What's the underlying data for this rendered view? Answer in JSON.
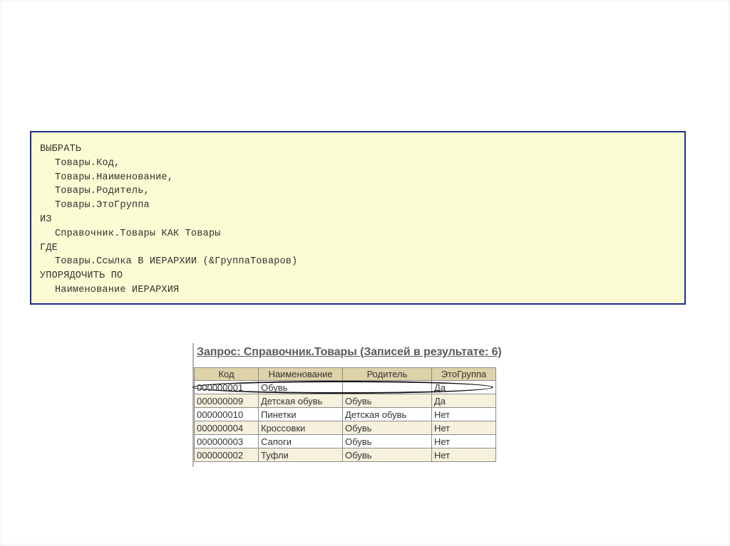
{
  "query": {
    "lines": [
      {
        "text": "ВЫБРАТЬ",
        "indent": false
      },
      {
        "text": "Товары.Код,",
        "indent": true
      },
      {
        "text": "Товары.Наименование,",
        "indent": true
      },
      {
        "text": "Товары.Родитель,",
        "indent": true
      },
      {
        "text": "Товары.ЭтоГруппа",
        "indent": true
      },
      {
        "text": "ИЗ",
        "indent": false
      },
      {
        "text": "Справочник.Товары КАК Товары",
        "indent": true
      },
      {
        "text": "ГДЕ",
        "indent": false
      },
      {
        "text": "Товары.Ссылка В ИЕРАРХИИ (&ГруппаТоваров)",
        "indent": true
      },
      {
        "text": "УПОРЯДОЧИТЬ ПО",
        "indent": false
      },
      {
        "text": "Наименование ИЕРАРХИЯ",
        "indent": true
      }
    ]
  },
  "result": {
    "title": "Запрос: Справочник.Товары (Записей в результате: 6)",
    "columns": [
      "Код",
      "Наименование",
      "Родитель",
      "ЭтоГруппа"
    ],
    "rows": [
      [
        "000000001",
        "Обувь",
        "",
        "Да"
      ],
      [
        "000000009",
        "Детская обувь",
        "Обувь",
        "Да"
      ],
      [
        "000000010",
        "Пинетки",
        "Детская обувь",
        "Нет"
      ],
      [
        "000000004",
        "Кроссовки",
        "Обувь",
        "Нет"
      ],
      [
        "000000003",
        "Сапоги",
        "Обувь",
        "Нет"
      ],
      [
        "000000002",
        "Туфли",
        "Обувь",
        "Нет"
      ]
    ],
    "highlighted_row": 0
  },
  "colors": {
    "query_background": "#fcfcd4",
    "query_border": "#1e2c8e",
    "table_header": "#ddd2a8"
  }
}
